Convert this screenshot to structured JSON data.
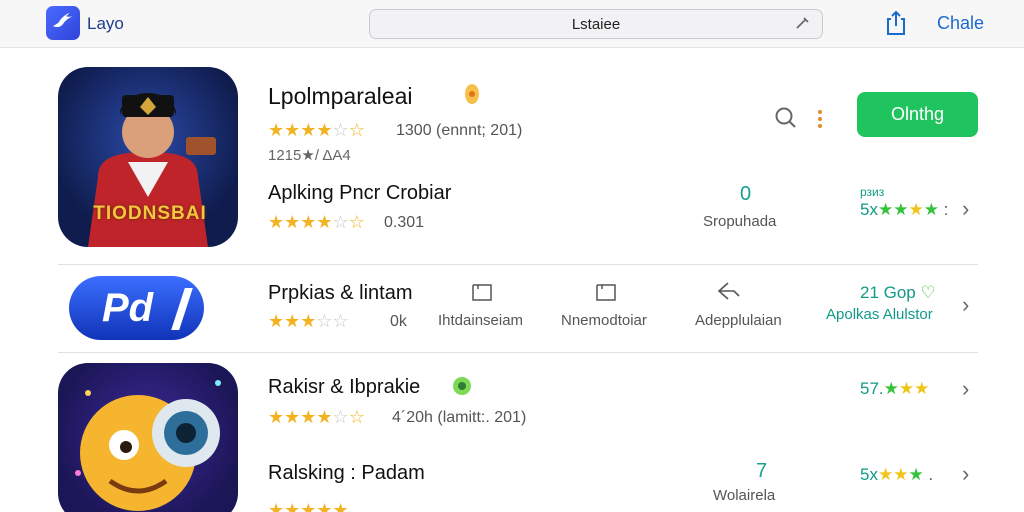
{
  "header": {
    "logo_text": "Layo",
    "search_value": "Lstaiee",
    "top_link": "Chale"
  },
  "apps": [
    {
      "title": "Lpolmparaleai",
      "rating_text": "1300  (ennnt;  201)",
      "downloads_text": "1215★/ ΔA4",
      "stars": 3.5,
      "icon_text": "TIODNSBAI",
      "get_label": "Olnthg"
    },
    {
      "subtitle": "Aplking Pncr Crobiar",
      "stars": 3.5,
      "meta": "0.301",
      "count_value": "0",
      "count_label": "Sropuhada",
      "rank_top": "рзиз",
      "rank_text": "5х"
    },
    {
      "title": "Prpkias & lintam",
      "stars": 3,
      "meta": "0k",
      "icon_text": "Pd",
      "col1": "Ihtdainseiam",
      "col2": "Nnemodtoiar",
      "col3": "Adepplulaian",
      "rank_top": "21 Gop",
      "rank_text": "Apolkas Alulstor"
    },
    {
      "title": "Rakisr & Ibprakie",
      "stars": 3.5,
      "meta": "4´20h (lamitt:. 201)",
      "rank_text": "57."
    },
    {
      "subtitle": "Ralsking : Padam",
      "count_value": "7",
      "count_label": "Wolairela",
      "rank_text": "5х"
    }
  ],
  "colors": {
    "accent_green": "#20c45e",
    "teal": "#16a08f",
    "star_gold": "#f2b322",
    "link_blue": "#1a6ad1"
  },
  "icons": [
    "bird-logo-icon",
    "clear-search-icon",
    "share-icon",
    "search-icon",
    "more-icon",
    "chevron-right-icon",
    "heart-icon",
    "badge-icon",
    "square-icon",
    "share-arrow-icon"
  ]
}
